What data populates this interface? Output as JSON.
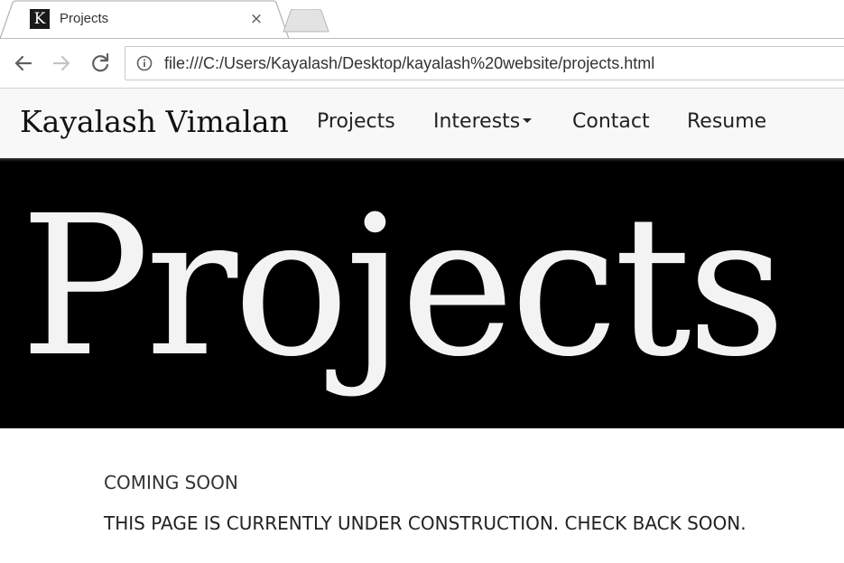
{
  "browser": {
    "tab": {
      "favicon_letter": "K",
      "title": "Projects",
      "close_glyph": "×"
    },
    "address_bar": {
      "url": "file:///C:/Users/Kayalash/Desktop/kayalash%20website/projects.html"
    },
    "icons": {
      "back": "back-arrow-icon",
      "forward": "forward-arrow-icon",
      "reload": "reload-icon",
      "info": "info-icon",
      "close": "close-icon"
    }
  },
  "site": {
    "brand": "Kayalash Vimalan",
    "nav": [
      {
        "label": "Projects"
      },
      {
        "label": "Interests"
      },
      {
        "label": "Contact"
      },
      {
        "label": "Resume"
      }
    ],
    "hero_title": "Projects",
    "content": {
      "heading": "COMING SOON",
      "message": "THIS PAGE IS CURRENTLY UNDER CONSTRUCTION. CHECK BACK SOON."
    }
  },
  "colors": {
    "hero_background": "#000000",
    "hero_text": "#f3f3f3",
    "navbar_background": "#f8f8f8"
  }
}
